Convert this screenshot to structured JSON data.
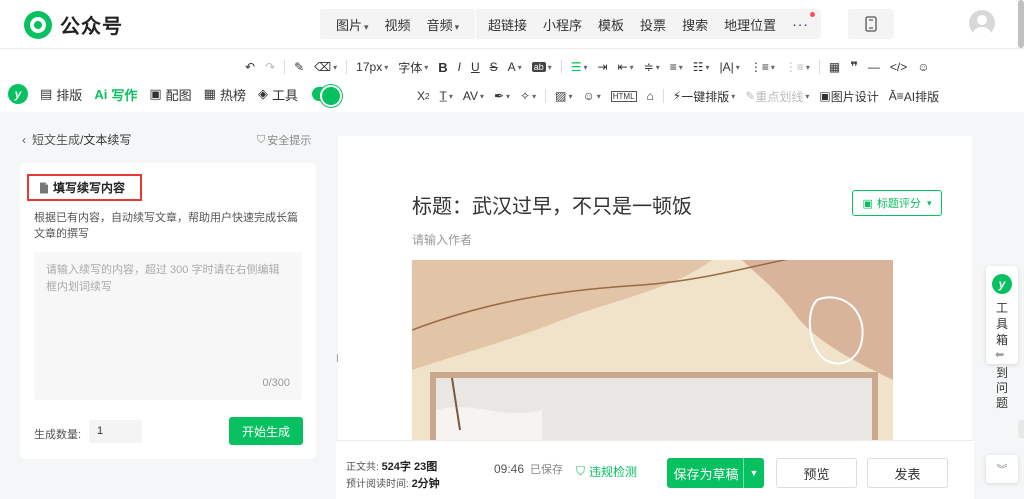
{
  "header": {
    "brand": "公众号",
    "media_items": [
      {
        "label": "图片",
        "caret": true
      },
      {
        "label": "视频",
        "caret": false
      },
      {
        "label": "音频",
        "caret": true
      }
    ],
    "tool_items": [
      "超链接",
      "小程序",
      "模板",
      "投票",
      "搜索",
      "地理位置"
    ],
    "more": "···",
    "accent": "#07c160",
    "notify_color": "#fa5151"
  },
  "toolbar": {
    "font_size": "17px",
    "font_family": "字体",
    "one_click_layout": "一键排版",
    "highlight": "重点划线",
    "image_design": "图片设计",
    "ai_layout": "AI排版",
    "html_label": "HTML"
  },
  "left_tabs": {
    "badge": "y",
    "items": [
      {
        "label": "排版",
        "icon": "layout-icon",
        "glyph": "▤",
        "active": false
      },
      {
        "label": "写作",
        "icon": "ai-write-icon",
        "glyph": "Ai",
        "active": true
      },
      {
        "label": "配图",
        "icon": "image-icon",
        "glyph": "▣",
        "active": false
      },
      {
        "label": "热榜",
        "icon": "book-icon",
        "glyph": "▦",
        "active": false
      },
      {
        "label": "工具",
        "icon": "cube-icon",
        "glyph": "◈",
        "active": false
      }
    ],
    "toggle_on": true
  },
  "panel": {
    "crumb_back": "短文生成",
    "crumb_sep": " /",
    "crumb_current": "文本续写",
    "safety_tip": "安全提示",
    "card_title": "填写续写内容",
    "card_desc": "根据已有内容，自动续写文章，帮助用户快速完成长篇文章的撰写",
    "textarea_placeholder": "请输入续写的内容，超过 300 字时请在右侧编辑框内划词续写",
    "counter": "0/300",
    "qty_label": "生成数量:",
    "qty_value": "1",
    "start_button": "开始生成"
  },
  "editor": {
    "title": "标题：武汉过早，不只是一顿饭",
    "score_button": "标题评分",
    "author_placeholder": "请输入作者"
  },
  "bottom": {
    "text_label": "正文共:",
    "text_value": "524字 23图",
    "read_label": "预计阅读时间:",
    "read_value": "2分钟",
    "saved_time": "09:46",
    "saved_label": "已保存",
    "violation": "违规检测",
    "save_draft": "保存为草稿",
    "preview": "预览",
    "publish": "发表"
  },
  "float": {
    "badge": "y",
    "toolbox": "工具箱",
    "help": "到问题"
  }
}
